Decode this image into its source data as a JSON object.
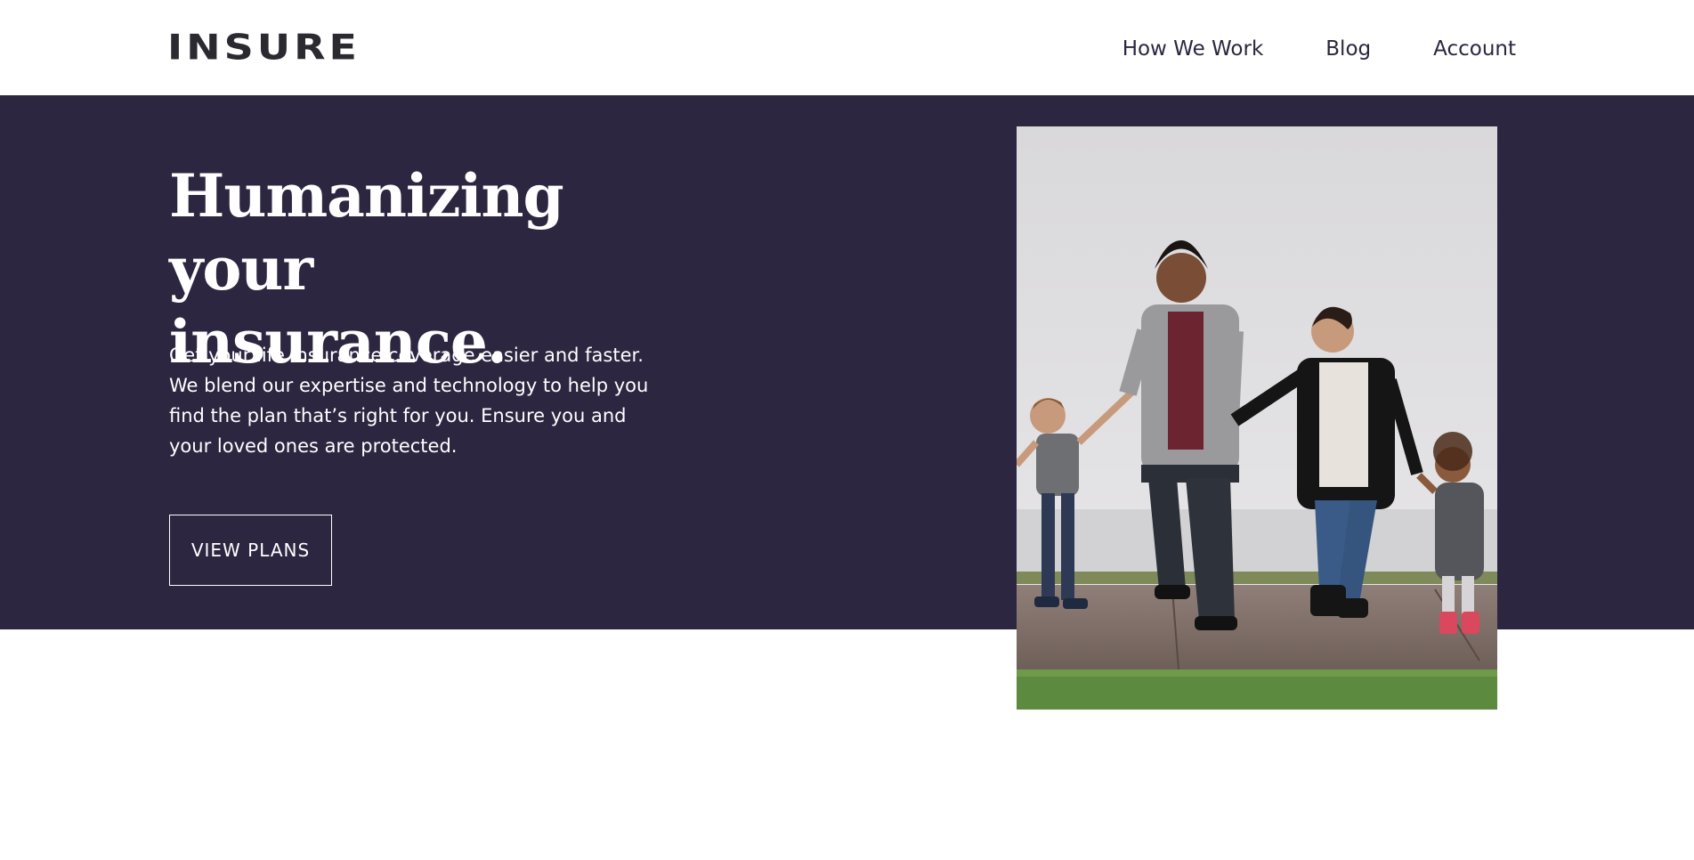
{
  "brand": {
    "logo_text": "INSURE",
    "accent_color": "#2c2640"
  },
  "nav": {
    "items": [
      {
        "label": "How We Work"
      },
      {
        "label": "Blog"
      },
      {
        "label": "Account"
      }
    ]
  },
  "hero": {
    "title_line1": "Humanizing",
    "title_line2": "your insurance.",
    "description": "Get your life insurance coverage easier and faster. We blend our expertise and technology to help you find the plan that’s right for you. Ensure you and your loved ones are protected.",
    "cta_label": "VIEW PLANS",
    "image_icon": "family-photo"
  }
}
